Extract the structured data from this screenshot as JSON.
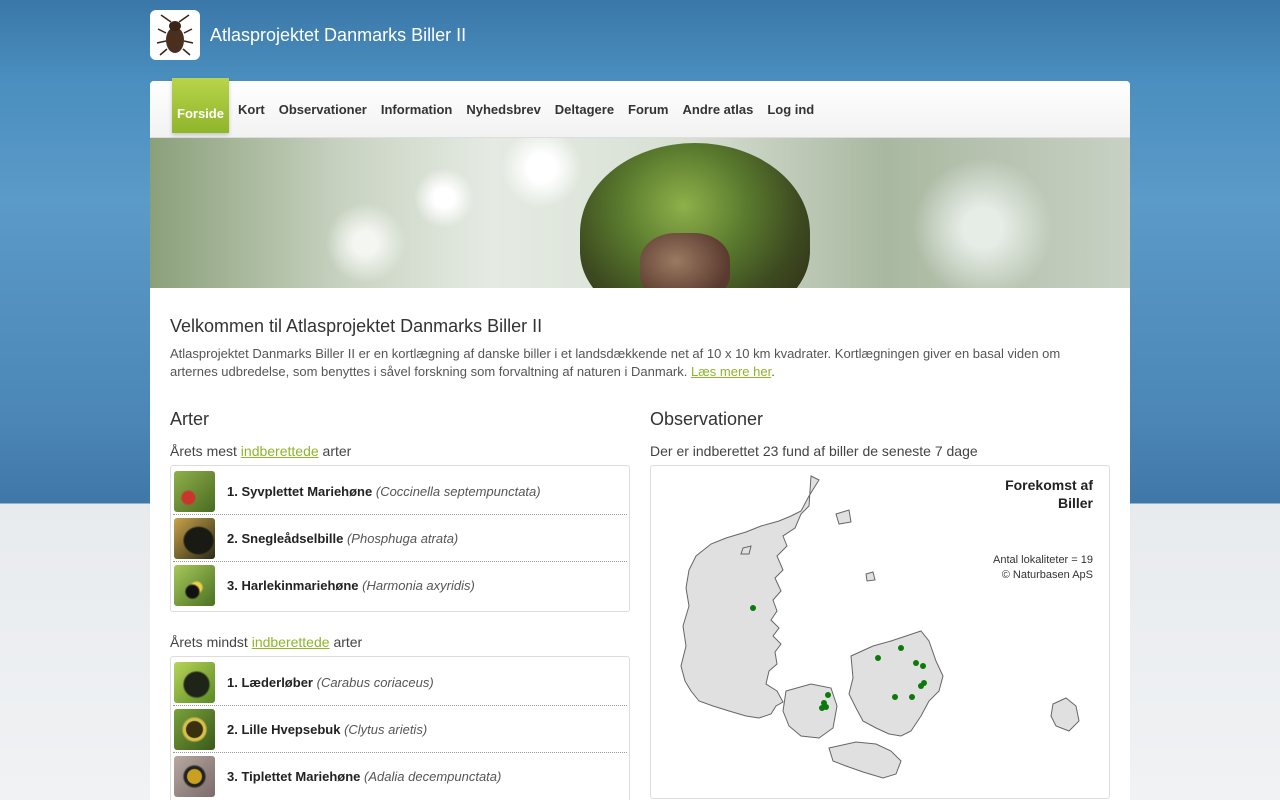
{
  "site": {
    "title": "Atlasprojektet Danmarks Biller II",
    "logo_icon": "beetle-logo-icon"
  },
  "nav": {
    "items": [
      {
        "label": "Forside",
        "active": true
      },
      {
        "label": "Kort"
      },
      {
        "label": "Observationer"
      },
      {
        "label": "Information"
      },
      {
        "label": "Nyhedsbrev"
      },
      {
        "label": "Deltagere"
      },
      {
        "label": "Forum"
      },
      {
        "label": "Andre atlas"
      },
      {
        "label": "Log ind"
      }
    ],
    "active_color": "#9cc033"
  },
  "welcome": {
    "title": "Velkommen til Atlasprojektet Danmarks Biller II",
    "text": "Atlasprojektet Danmarks Biller II er en kortlægning af danske biller i et landsdækkende net af 10 x 10 km kvadrater. Kortlægningen giver en basal viden om arternes udbredelse, som benyttes i såvel forskning som forvaltning af naturen i Danmark.",
    "link": "Læs mere her",
    "link_color": "#8fb52a"
  },
  "species": {
    "title": "Arter",
    "most": {
      "prefix": "Årets mest",
      "link": "indberettede",
      "suffix": "arter",
      "items": [
        {
          "rank": "1.",
          "name": "Syvplettet Mariehøne",
          "latin": "(Coccinella septempunctata)"
        },
        {
          "rank": "2.",
          "name": "Snegleådselbille",
          "latin": "(Phosphuga atrata)"
        },
        {
          "rank": "3.",
          "name": "Harlekinmariehøne",
          "latin": "(Harmonia axyridis)"
        }
      ]
    },
    "least": {
      "prefix": "Årets mindst",
      "link": "indberettede",
      "suffix": "arter",
      "items": [
        {
          "rank": "1.",
          "name": "Læderløber",
          "latin": "(Carabus coriaceus)"
        },
        {
          "rank": "2.",
          "name": "Lille Hvepsebuk",
          "latin": "(Clytus arietis)"
        },
        {
          "rank": "3.",
          "name": "Tiplettet Mariehøne",
          "latin": "(Adalia decempunctata)"
        }
      ]
    }
  },
  "observations": {
    "title": "Observationer",
    "subtitle": "Der er indberettet 23 fund af biller de seneste 7 dage",
    "map": {
      "title_line1": "Forekomst af",
      "title_line2": "Biller",
      "legend_line1": "Antal lokaliteter = 19",
      "legend_line2": "© Naturbasen ApS"
    }
  }
}
